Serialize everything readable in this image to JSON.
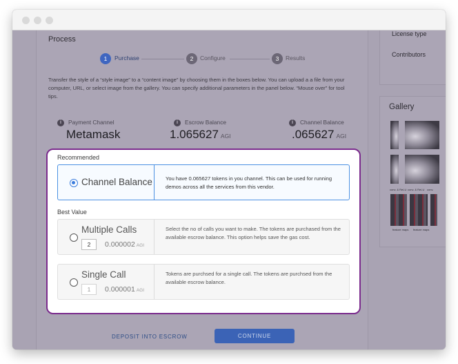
{
  "process": {
    "title": "Process",
    "steps": [
      {
        "number": "1",
        "label": "Purchase",
        "active": true
      },
      {
        "number": "2",
        "label": "Configure",
        "active": false
      },
      {
        "number": "3",
        "label": "Results",
        "active": false
      }
    ],
    "intro": "Transfer the style of a “style image” to a “content image” by choosing them in the boxes below.  You can upload a a file from your computer, URL, or select image from the gallery.  You can specify additional parameters in the panel below.  “Mouse over” for tool tips."
  },
  "balances": {
    "payment": {
      "label": "Payment Channel",
      "value": "Metamask",
      "unit": ""
    },
    "escrow": {
      "label": "Escrow Balance",
      "value": "1.065627",
      "unit": "AGI"
    },
    "channel": {
      "label": "Channel Balance",
      "value": ".065627",
      "unit": "AGI"
    }
  },
  "recommended": {
    "title": "Recommended",
    "option": {
      "name": "Channel Balance",
      "selected": true,
      "description": "You have 0.065627 tokens in you channel. This can be used for running demos across all the services from this vendor."
    }
  },
  "best_value": {
    "title": "Best Value",
    "options": [
      {
        "name": "Multiple Calls",
        "quantity": "2",
        "price": "0.000002",
        "unit": "AGI",
        "selected": false,
        "description": "Select the no of calls you want to make. The tokens are purchased from the available escrow balance. This  option helps save the gas cost."
      },
      {
        "name": "Single Call",
        "quantity": "1",
        "price": "0.000001",
        "unit": "AGI",
        "selected": false,
        "description": "Tokens are purchsed for a single call. The tokens are purchsed from the available escrow balance."
      }
    ]
  },
  "actions": {
    "deposit": "DEPOSIT INTO ESCROW",
    "continue": "CONTINUE"
  },
  "sidebar": {
    "items": [
      "License type",
      "Contributors"
    ],
    "gallery_title": "Gallery",
    "thumb_labels": [
      "conv. & ReLU",
      "conv. & ReLU",
      "conv.",
      "feature maps",
      "feature maps"
    ]
  },
  "colors": {
    "accent_purple": "#7a2a8c",
    "accent_blue": "#3b63b6",
    "overlay": "#a9a3b3"
  }
}
